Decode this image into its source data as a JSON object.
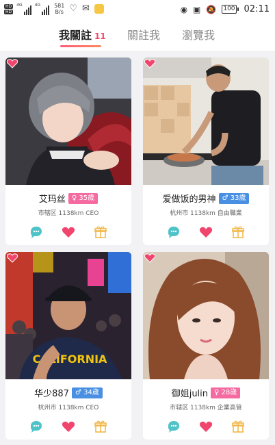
{
  "status_bar": {
    "hd_labels": [
      "HD",
      "HD"
    ],
    "network_1": "4G",
    "network_2": "4G",
    "speed_value": "581",
    "speed_unit": "B/s",
    "battery": "100",
    "time": "02:11"
  },
  "tabs": [
    {
      "label": "我關註",
      "count": "11",
      "active": true
    },
    {
      "label": "關註我",
      "active": false
    },
    {
      "label": "瀏覽我",
      "active": false
    }
  ],
  "colors": {
    "accent": "#f04a6a",
    "female_badge": "#f56aa0",
    "male_badge": "#4a90e2",
    "chat_icon": "#4fc3c8",
    "heart_icon": "#f0466e",
    "gift_icon": "#f2b84b"
  },
  "cards": [
    {
      "name": "艾玛丝",
      "gender": "female",
      "age": "35歲",
      "meta": "市辖区 1138km CEO"
    },
    {
      "name": "爱做饭的男神",
      "gender": "male",
      "age": "33歲",
      "meta": "杭州市 1138km 自由職業"
    },
    {
      "name": "华少887",
      "gender": "male",
      "age": "34歲",
      "meta": "杭州市 1138km CEO"
    },
    {
      "name": "御姐julin",
      "gender": "female",
      "age": "28歲",
      "meta": "市辖区 1138km 企業高管"
    }
  ],
  "card_icons": [
    "chat-icon",
    "heart-icon",
    "gift-icon"
  ]
}
